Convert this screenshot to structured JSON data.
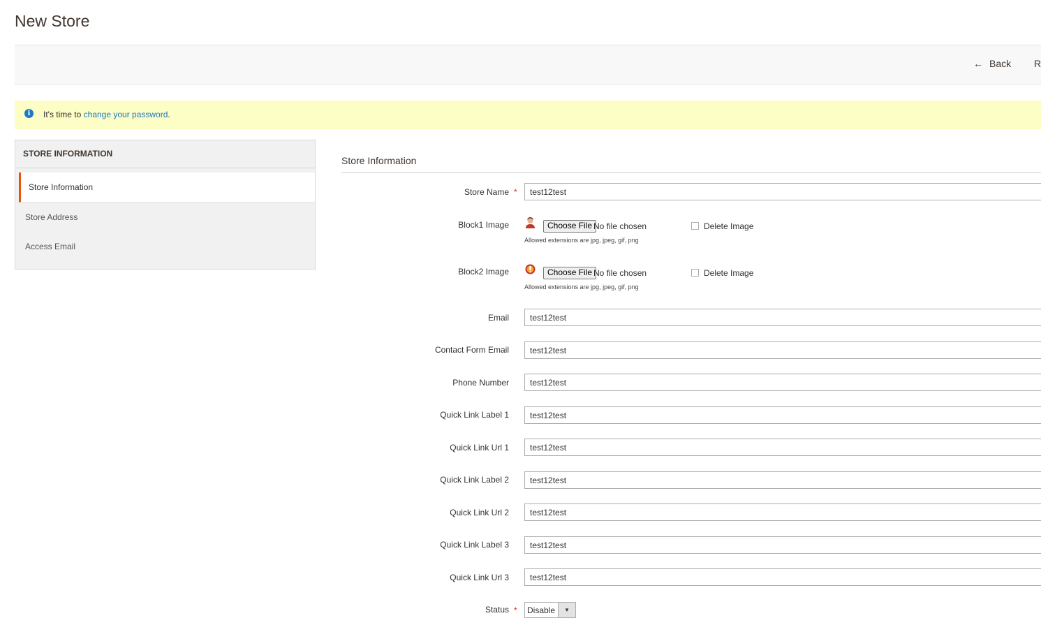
{
  "page": {
    "title": "New Store"
  },
  "actions": {
    "back_arrow": "←",
    "back_label": "Back",
    "reset_label_cut": "Re"
  },
  "notice": {
    "icon": "info-icon",
    "prefix": "It's time to ",
    "link_text": "change your password",
    "suffix": "."
  },
  "sidebar": {
    "title": "STORE INFORMATION",
    "items": [
      {
        "label": "Store Information",
        "active": true
      },
      {
        "label": "Store Address",
        "active": false
      },
      {
        "label": "Access Email",
        "active": false
      }
    ]
  },
  "form": {
    "section_title": "Store Information",
    "required_mark": "*",
    "store_name": {
      "label": "Store Name",
      "value": "test12test"
    },
    "block1": {
      "label": "Block1 Image",
      "button": "Choose File",
      "status": "No file chosen",
      "delete_label": "Delete Image",
      "note": "Allowed extensions are jpg, jpeg, gif, png"
    },
    "block2": {
      "label": "Block2 Image",
      "button": "Choose File",
      "status": "No file chosen",
      "delete_label": "Delete Image",
      "note": "Allowed extensions are jpg, jpeg, gif, png"
    },
    "fields": [
      {
        "label": "Email",
        "value": "test12test"
      },
      {
        "label": "Contact Form Email",
        "value": "test12test"
      },
      {
        "label": "Phone Number",
        "value": "test12test"
      },
      {
        "label": "Quick Link Label 1",
        "value": "test12test"
      },
      {
        "label": "Quick Link Url 1",
        "value": "test12test"
      },
      {
        "label": "Quick Link Label 2",
        "value": "test12test"
      },
      {
        "label": "Quick Link Url 2",
        "value": "test12test"
      },
      {
        "label": "Quick Link Label 3",
        "value": "test12test"
      },
      {
        "label": "Quick Link Url 3",
        "value": "test12test"
      }
    ],
    "status": {
      "label": "Status",
      "value": "Disable",
      "caret": "▼"
    }
  },
  "colors": {
    "accent": "#eb5202",
    "link": "#1979c3",
    "notice_bg": "#fdfdc6",
    "required": "#e22626"
  }
}
